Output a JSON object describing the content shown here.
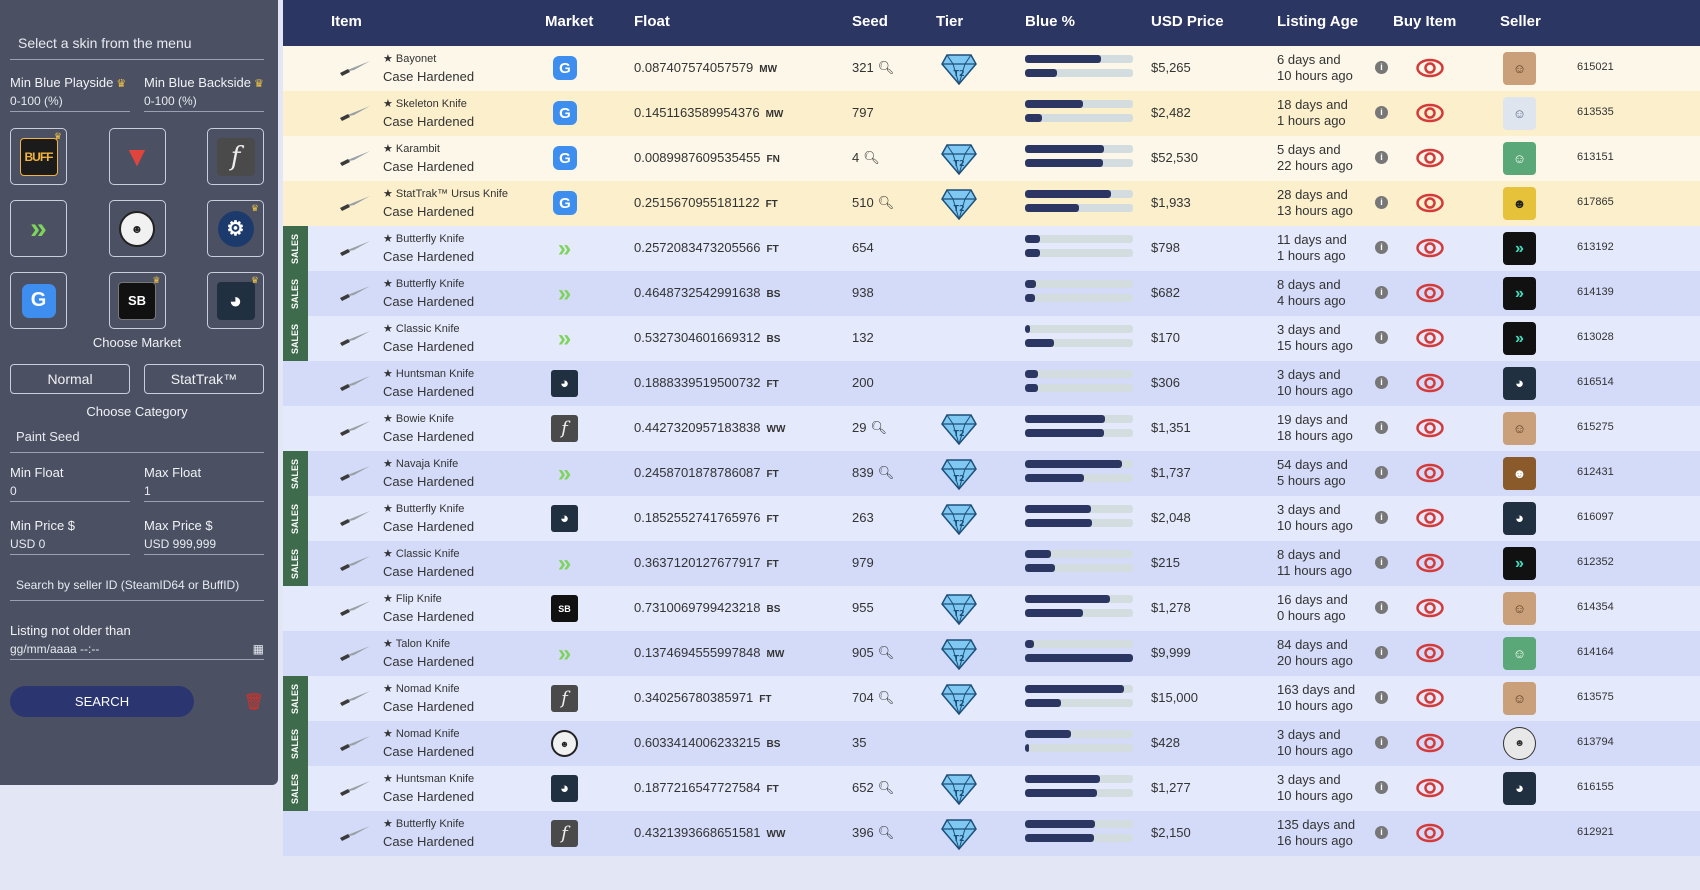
{
  "sidebar": {
    "select_skin": "Select a skin from the menu",
    "min_blue_playside_label": "Min Blue Playside",
    "min_blue_playside_value": "0-100 (%)",
    "min_blue_backside_label": "Min Blue Backside",
    "min_blue_backside_value": "0-100 (%)",
    "crown": "♛",
    "markets": [
      {
        "name": "BUFF",
        "icon": "buff-icon",
        "premium": true
      },
      {
        "name": "DMarket",
        "icon": "dmarket-icon",
        "premium": false
      },
      {
        "name": "CSFloat",
        "icon": "csfloat-icon",
        "premium": false
      },
      {
        "name": "Skinport",
        "icon": "skinport-icon",
        "premium": false
      },
      {
        "name": "Bitskins",
        "icon": "bitskins-icon",
        "premium": false
      },
      {
        "name": "Steam",
        "icon": "steam-icon",
        "premium": true
      },
      {
        "name": "Gamerpay",
        "icon": "gamerpay-icon",
        "premium": false
      },
      {
        "name": "Skinbaron",
        "icon": "skinbaron-icon",
        "premium": true
      },
      {
        "name": "Piranha",
        "icon": "piranha-icon",
        "premium": true
      }
    ],
    "choose_market": "Choose Market",
    "normal_label": "Normal",
    "stattrak_label": "StatTrak™",
    "choose_category": "Choose Category",
    "paint_seed": "Paint Seed",
    "min_float_label": "Min Float",
    "min_float_value": "0",
    "max_float_label": "Max Float",
    "max_float_value": "1",
    "min_price_label": "Min Price $",
    "min_price_value": "USD 0",
    "max_price_label": "Max Price $",
    "max_price_value": "USD 999,999",
    "seller_search": "Search by seller ID (SteamID64 or BuffID)",
    "listing_label": "Listing not older than",
    "listing_placeholder": "gg/mm/aaaa  --:--",
    "search_label": "SEARCH"
  },
  "table": {
    "headers": {
      "item": "Item",
      "market": "Market",
      "float": "Float",
      "seed": "Seed",
      "tier": "Tier",
      "blue": "Blue %",
      "price": "USD Price",
      "age": "Listing Age",
      "buy": "Buy Item",
      "seller": "Seller"
    },
    "sales_label": "SALES",
    "rows": [
      {
        "name": "★ Bayonet",
        "pattern": "Case Hardened",
        "market": "gm",
        "float": "0.087407574057579",
        "wear": "MW",
        "seed": "321",
        "mag": true,
        "tier": true,
        "blue1": 0.7,
        "blue2": 0.3,
        "price": "$5,265",
        "age1": "6 days and",
        "age2": "10 hours ago",
        "avatar": "face",
        "sid": "615021",
        "sales": false,
        "bg": "#fcf7e8"
      },
      {
        "name": "★ Skeleton Knife",
        "pattern": "Case Hardened",
        "market": "gm",
        "float": "0.1451163589954376",
        "wear": "MW",
        "seed": "797",
        "mag": false,
        "tier": false,
        "blue1": 0.54,
        "blue2": 0.16,
        "price": "$2,482",
        "age1": "18 days and",
        "age2": "1 hours ago",
        "avatar": "anime",
        "sid": "613535",
        "sales": false,
        "bg": "#fbefcc"
      },
      {
        "name": "★ Karambit",
        "pattern": "Case Hardened",
        "market": "gm",
        "float": "0.0089987609535455",
        "wear": "FN",
        "seed": "4",
        "mag": true,
        "tier": true,
        "blue1": 0.73,
        "blue2": 0.72,
        "price": "$52,530",
        "age1": "5 days and",
        "age2": "22 hours ago",
        "avatar": "green",
        "sid": "613151",
        "sales": false,
        "bg": "#fcf7e8"
      },
      {
        "name": "★ StatTrak™ Ursus Knife",
        "pattern": "Case Hardened",
        "market": "gm",
        "float": "0.2515670955181122",
        "wear": "FT",
        "seed": "510",
        "mag": true,
        "tier": true,
        "blue1": 0.8,
        "blue2": 0.5,
        "price": "$1,933",
        "age1": "28 days and",
        "age2": "13 hours ago",
        "avatar": "yellow",
        "sid": "617865",
        "sales": false,
        "bg": "#fbefcc"
      },
      {
        "name": "★ Butterfly Knife",
        "pattern": "Case Hardened",
        "market": "sp",
        "float": "0.2572083473205566",
        "wear": "FT",
        "seed": "654",
        "mag": false,
        "tier": false,
        "blue1": 0.14,
        "blue2": 0.14,
        "price": "$798",
        "age1": "11 days and",
        "age2": "1 hours ago",
        "avatar": "sp",
        "sid": "613192",
        "sales": true,
        "bg": "#e4e9fb"
      },
      {
        "name": "★ Butterfly Knife",
        "pattern": "Case Hardened",
        "market": "sp",
        "float": "0.4648732542991638",
        "wear": "BS",
        "seed": "938",
        "mag": false,
        "tier": false,
        "blue1": 0.1,
        "blue2": 0.09,
        "price": "$682",
        "age1": "8 days and",
        "age2": "4 hours ago",
        "avatar": "sp",
        "sid": "614139",
        "sales": true,
        "bg": "#d4dbf8"
      },
      {
        "name": "★ Classic Knife",
        "pattern": "Case Hardened",
        "market": "sp",
        "float": "0.5327304601669312",
        "wear": "BS",
        "seed": "132",
        "mag": false,
        "tier": false,
        "blue1": 0.05,
        "blue2": 0.27,
        "price": "$170",
        "age1": "3 days and",
        "age2": "15 hours ago",
        "avatar": "sp",
        "sid": "613028",
        "sales": true,
        "bg": "#e4e9fb"
      },
      {
        "name": "★ Huntsman Knife",
        "pattern": "Case Hardened",
        "market": "pi",
        "float": "0.1888339519500732",
        "wear": "FT",
        "seed": "200",
        "mag": false,
        "tier": false,
        "blue1": 0.12,
        "blue2": 0.12,
        "price": "$306",
        "age1": "3 days and",
        "age2": "10 hours ago",
        "avatar": "pi",
        "sid": "616514",
        "sales": false,
        "bg": "#d4dbf8"
      },
      {
        "name": "★ Bowie Knife",
        "pattern": "Case Hardened",
        "market": "ct",
        "float": "0.4427320957183838",
        "wear": "WW",
        "seed": "29",
        "mag": true,
        "tier": true,
        "blue1": 0.74,
        "blue2": 0.73,
        "price": "$1,351",
        "age1": "19 days and",
        "age2": "18 hours ago",
        "avatar": "face",
        "sid": "615275",
        "sales": false,
        "bg": "#e4e9fb"
      },
      {
        "name": "★ Navaja Knife",
        "pattern": "Case Hardened",
        "market": "sp",
        "float": "0.2458701878786087",
        "wear": "FT",
        "seed": "839",
        "mag": true,
        "tier": true,
        "blue1": 0.9,
        "blue2": 0.55,
        "price": "$1,737",
        "age1": "54 days and",
        "age2": "5 hours ago",
        "avatar": "dark",
        "sid": "612431",
        "sales": true,
        "bg": "#d4dbf8"
      },
      {
        "name": "★ Butterfly Knife",
        "pattern": "Case Hardened",
        "market": "pi",
        "float": "0.1852552741765976",
        "wear": "FT",
        "seed": "263",
        "mag": false,
        "tier": true,
        "blue1": 0.61,
        "blue2": 0.62,
        "price": "$2,048",
        "age1": "3 days and",
        "age2": "10 hours ago",
        "avatar": "pi",
        "sid": "616097",
        "sales": true,
        "bg": "#e4e9fb"
      },
      {
        "name": "★ Classic Knife",
        "pattern": "Case Hardened",
        "market": "sp",
        "float": "0.3637120127677917",
        "wear": "FT",
        "seed": "979",
        "mag": false,
        "tier": false,
        "blue1": 0.24,
        "blue2": 0.28,
        "price": "$215",
        "age1": "8 days and",
        "age2": "11 hours ago",
        "avatar": "sp",
        "sid": "612352",
        "sales": true,
        "bg": "#d4dbf8"
      },
      {
        "name": "★ Flip Knife",
        "pattern": "Case Hardened",
        "market": "sb",
        "float": "0.7310069799423218",
        "wear": "BS",
        "seed": "955",
        "mag": false,
        "tier": true,
        "blue1": 0.79,
        "blue2": 0.54,
        "price": "$1,278",
        "age1": "16 days and",
        "age2": "0 hours ago",
        "avatar": "face",
        "sid": "614354",
        "sales": false,
        "bg": "#e4e9fb"
      },
      {
        "name": "★ Talon Knife",
        "pattern": "Case Hardened",
        "market": "sp",
        "float": "0.1374694555997848",
        "wear": "MW",
        "seed": "905",
        "mag": true,
        "tier": true,
        "blue1": 0.08,
        "blue2": 1.0,
        "price": "$9,999",
        "age1": "84 days and",
        "age2": "20 hours ago",
        "avatar": "green",
        "sid": "614164",
        "sales": false,
        "bg": "#d4dbf8"
      },
      {
        "name": "★ Nomad Knife",
        "pattern": "Case Hardened",
        "market": "ct",
        "float": "0.340256780385971",
        "wear": "FT",
        "seed": "704",
        "mag": true,
        "tier": true,
        "blue1": 0.92,
        "blue2": 0.33,
        "price": "$15,000",
        "age1": "163 days and",
        "age2": "10 hours ago",
        "avatar": "face",
        "sid": "613575",
        "sales": true,
        "bg": "#e4e9fb"
      },
      {
        "name": "★ Nomad Knife",
        "pattern": "Case Hardened",
        "market": "bg",
        "float": "0.6033414006233215",
        "wear": "BS",
        "seed": "35",
        "mag": false,
        "tier": false,
        "blue1": 0.43,
        "blue2": 0.04,
        "price": "$428",
        "age1": "3 days and",
        "age2": "10 hours ago",
        "avatar": "cs",
        "sid": "613794",
        "sales": true,
        "bg": "#d4dbf8"
      },
      {
        "name": "★ Huntsman Knife",
        "pattern": "Case Hardened",
        "market": "pi",
        "float": "0.1877216547727584",
        "wear": "FT",
        "seed": "652",
        "mag": true,
        "tier": true,
        "blue1": 0.69,
        "blue2": 0.67,
        "price": "$1,277",
        "age1": "3 days and",
        "age2": "10 hours ago",
        "avatar": "pi",
        "sid": "616155",
        "sales": true,
        "bg": "#e4e9fb"
      },
      {
        "name": "★ Butterfly Knife",
        "pattern": "Case Hardened",
        "market": "ct",
        "float": "0.4321393668651581",
        "wear": "WW",
        "seed": "396",
        "mag": true,
        "tier": true,
        "blue1": 0.65,
        "blue2": 0.64,
        "price": "$2,150",
        "age1": "135 days and",
        "age2": "16 hours ago",
        "avatar": "none",
        "sid": "612921",
        "sales": false,
        "bg": "#d4dbf8"
      }
    ]
  },
  "colors": {
    "header": "#2c3663",
    "bar_fill": "#2c3663",
    "bar_track": "#d3dde0",
    "sales": "#3e6b4b",
    "eye": "#d33b3b",
    "diamond": "#5ab0e8"
  }
}
